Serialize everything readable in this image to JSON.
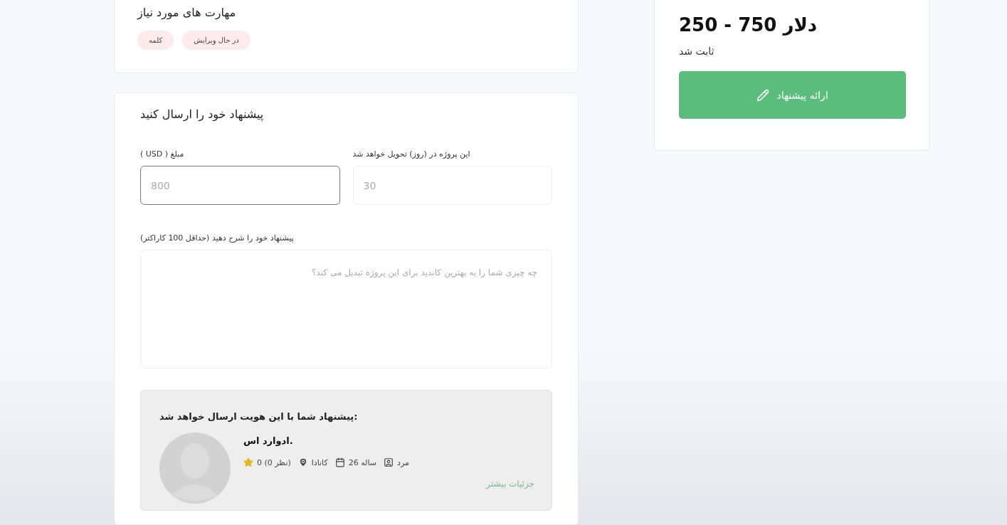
{
  "skills": {
    "title": "مهارت های مورد نیاز",
    "tags": [
      "در حال ویرایش",
      "کلمه"
    ]
  },
  "offer_form": {
    "title": "پیشنهاد خود را ارسال کنید",
    "fields": [
      {
        "kind": "input",
        "label": "این پروژه در (روز) تحویل خواهد شد",
        "placeholder": "30",
        "focused": false
      },
      {
        "kind": "input",
        "label": "( USD ) مبلغ",
        "placeholder": "800",
        "focused": true
      },
      {
        "kind": "textarea",
        "label": "پیشنهاد خود را شرح دهید (حداقل 100 کاراکتر)",
        "placeholder": "چه چیزی شما را به بهترین کاندید برای این پروژه تبدیل می کند؟",
        "focused": false
      }
    ],
    "identity": {
      "heading": "پیشنهاد شما با این هویت ارسال خواهد شد:",
      "name": "ادوارد اس.",
      "meta": [
        {
          "kind": "gender",
          "text": "مرد"
        },
        {
          "kind": "age",
          "text": "26 ساله"
        },
        {
          "kind": "location",
          "text": "کانادا"
        },
        {
          "kind": "rating",
          "text": "0 (0 نظر)"
        }
      ],
      "more_link": "جزئیات بیشتر"
    }
  },
  "sidebar": {
    "price": "250 - 750 دلار",
    "price_type": "ثابت شد",
    "button": "ارائه پیشنهاد"
  }
}
